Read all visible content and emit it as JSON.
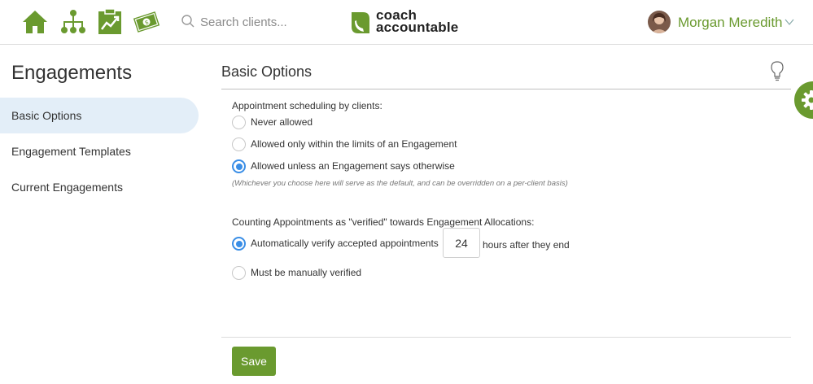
{
  "header": {
    "nav_icons": [
      "home-icon",
      "org-chart-icon",
      "clipboard-chart-icon",
      "money-icon"
    ],
    "search": {
      "placeholder": "Search clients..."
    },
    "logo": {
      "line1": "coach",
      "line2": "accountable"
    },
    "user": {
      "name": "Morgan Meredith"
    },
    "brand_color": "#6a9a2f"
  },
  "sidebar": {
    "title": "Engagements",
    "items": [
      {
        "label": "Basic Options",
        "active": true
      },
      {
        "label": "Engagement Templates",
        "active": false
      },
      {
        "label": "Current Engagements",
        "active": false
      }
    ]
  },
  "main": {
    "title": "Basic Options",
    "scheduling": {
      "label": "Appointment scheduling by clients:",
      "options": [
        {
          "label": "Never allowed",
          "checked": false
        },
        {
          "label": "Allowed only within the limits of an Engagement",
          "checked": false
        },
        {
          "label": "Allowed unless an Engagement says otherwise",
          "checked": true
        }
      ],
      "note": "(Whichever you choose here will serve as the default, and can be overridden on a per-client basis)"
    },
    "counting": {
      "label": "Counting Appointments as \"verified\" towards Engagement Allocations:",
      "options": [
        {
          "label": "Automatically verify accepted appointments",
          "checked": true
        },
        {
          "label": "Must be manually verified",
          "checked": false
        }
      ],
      "hours_value": "24",
      "after_text": "hours after they end"
    },
    "save_label": "Save"
  },
  "colors": {
    "accent_blue": "#3a8ee6",
    "active_bg": "#e3eef8"
  }
}
